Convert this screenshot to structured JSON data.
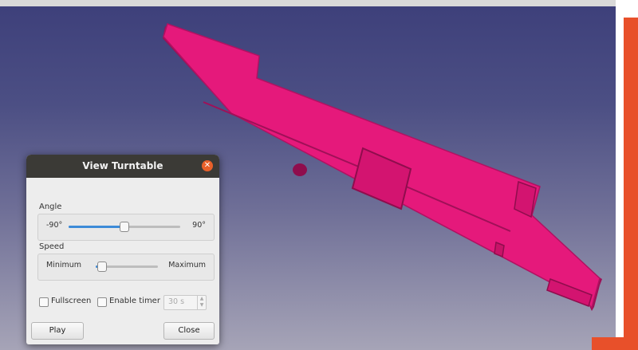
{
  "dialog": {
    "title": "View Turntable",
    "angle": {
      "label": "Angle",
      "min_label": "-90°",
      "max_label": "90°",
      "value_fraction": 0.5
    },
    "speed": {
      "label": "Speed",
      "min_label": "Minimum",
      "max_label": "Maximum",
      "value_fraction": 0.05
    },
    "fullscreen_label": "Fullscreen",
    "enable_timer_label": "Enable timer",
    "timer_value": "30 s",
    "play_label": "Play",
    "close_label": "Close"
  },
  "colors": {
    "model": "#e5197b",
    "accent": "#e8502a",
    "slider_fill": "#3d8bd8",
    "titlebar": "#3b3a36",
    "close_button": "#e8602a"
  },
  "icons": {
    "dialog_close": "close-icon",
    "spin_arrows": "spin-arrows-icon"
  }
}
